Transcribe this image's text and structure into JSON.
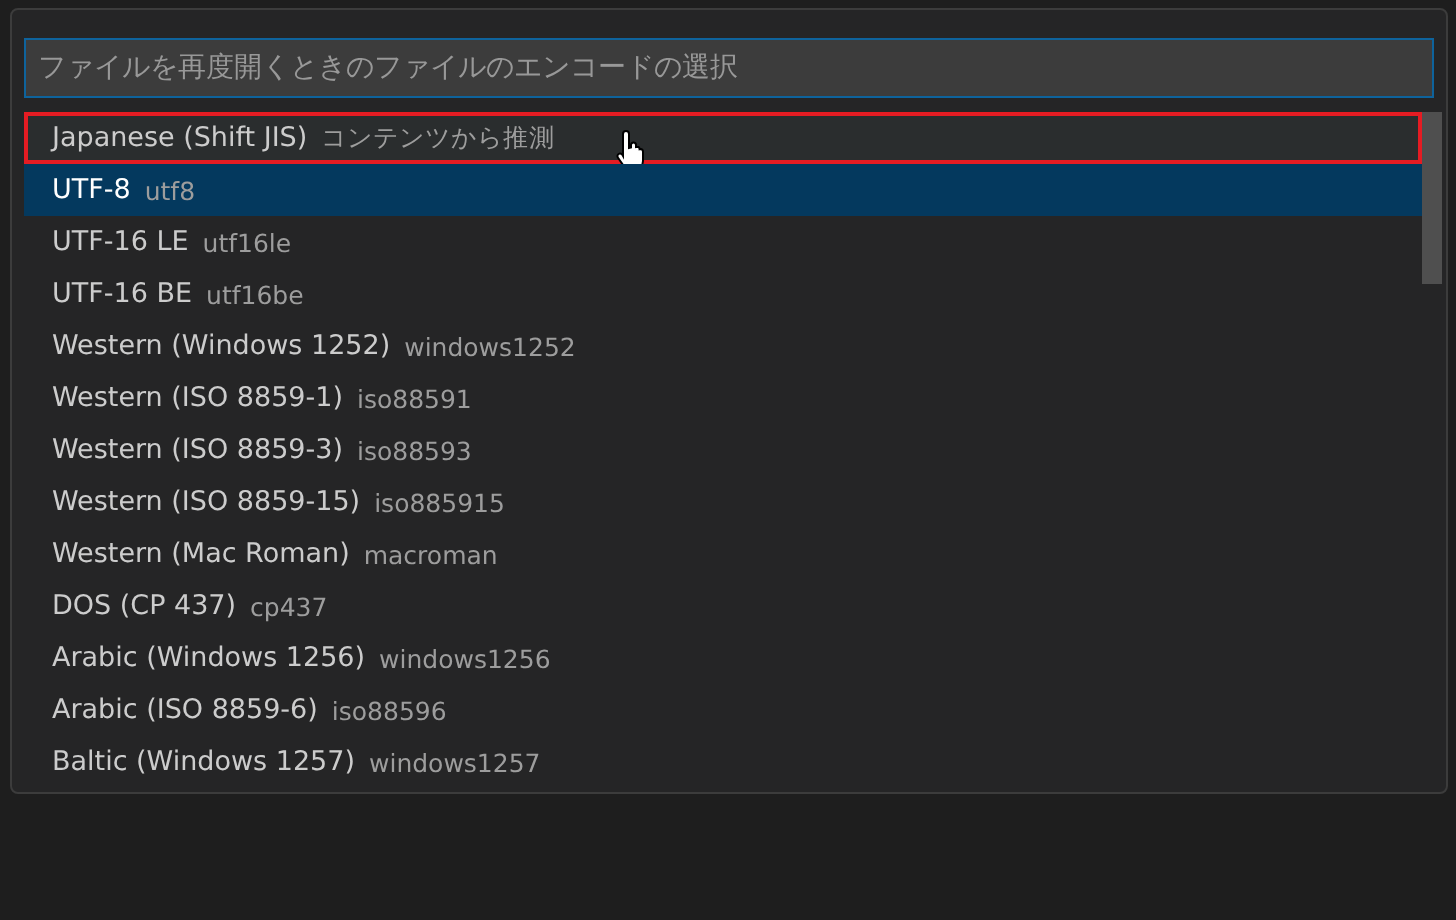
{
  "picker": {
    "placeholder": "ファイルを再度開くときのファイルのエンコードの選択",
    "items": [
      {
        "label": "Japanese (Shift JIS)",
        "detail": "コンテンツから推測",
        "selected": false,
        "hovered": true
      },
      {
        "label": "UTF-8",
        "detail": "utf8",
        "selected": true,
        "hovered": false
      },
      {
        "label": "UTF-16 LE",
        "detail": "utf16le",
        "selected": false,
        "hovered": false
      },
      {
        "label": "UTF-16 BE",
        "detail": "utf16be",
        "selected": false,
        "hovered": false
      },
      {
        "label": "Western (Windows 1252)",
        "detail": "windows1252",
        "selected": false,
        "hovered": false
      },
      {
        "label": "Western (ISO 8859-1)",
        "detail": "iso88591",
        "selected": false,
        "hovered": false
      },
      {
        "label": "Western (ISO 8859-3)",
        "detail": "iso88593",
        "selected": false,
        "hovered": false
      },
      {
        "label": "Western (ISO 8859-15)",
        "detail": "iso885915",
        "selected": false,
        "hovered": false
      },
      {
        "label": "Western (Mac Roman)",
        "detail": "macroman",
        "selected": false,
        "hovered": false
      },
      {
        "label": "DOS (CP 437)",
        "detail": "cp437",
        "selected": false,
        "hovered": false
      },
      {
        "label": "Arabic (Windows 1256)",
        "detail": "windows1256",
        "selected": false,
        "hovered": false
      },
      {
        "label": "Arabic (ISO 8859-6)",
        "detail": "iso88596",
        "selected": false,
        "hovered": false
      },
      {
        "label": "Baltic (Windows 1257)",
        "detail": "windows1257",
        "selected": false,
        "hovered": false
      }
    ]
  }
}
